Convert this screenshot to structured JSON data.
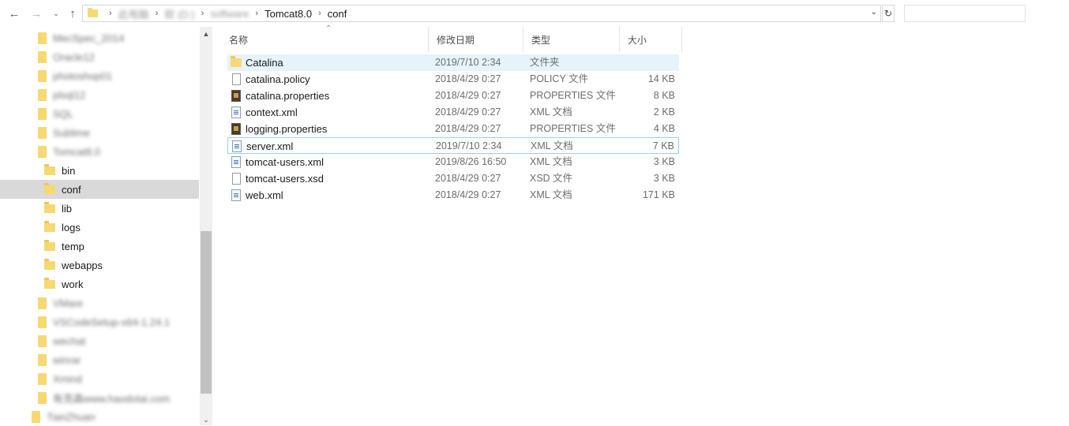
{
  "toolbar": {
    "back_icon": "arrow-left-icon",
    "forward_icon": "arrow-right-icon",
    "recent_icon": "chevron-down-icon",
    "up_icon": "arrow-up-icon"
  },
  "address": {
    "crumbs": [
      "此电脑",
      "软 (D:)",
      "software",
      "Tomcat8.0",
      "conf"
    ],
    "blurred_count": 3,
    "dropdown_icon": "chevron-down-icon",
    "refresh_icon": "refresh-icon"
  },
  "nav": {
    "items": [
      {
        "label": "MecSpec_2014",
        "blur": true,
        "indent": 1
      },
      {
        "label": "Oracle12",
        "blur": true,
        "indent": 1
      },
      {
        "label": "photoshop01",
        "blur": true,
        "indent": 1
      },
      {
        "label": "plsql12",
        "blur": true,
        "indent": 1
      },
      {
        "label": "SQL",
        "blur": true,
        "indent": 1
      },
      {
        "label": "Sublime",
        "blur": true,
        "indent": 1
      },
      {
        "label": "Tomcat8.0",
        "blur": true,
        "indent": 1
      },
      {
        "label": "bin",
        "blur": false,
        "indent": 2
      },
      {
        "label": "conf",
        "blur": false,
        "indent": 2,
        "selected": true
      },
      {
        "label": "lib",
        "blur": false,
        "indent": 2
      },
      {
        "label": "logs",
        "blur": false,
        "indent": 2
      },
      {
        "label": "temp",
        "blur": false,
        "indent": 2
      },
      {
        "label": "webapps",
        "blur": false,
        "indent": 2
      },
      {
        "label": "work",
        "blur": false,
        "indent": 2
      },
      {
        "label": "VMare",
        "blur": true,
        "indent": 1
      },
      {
        "label": "VSCodeSetup-x64-1.24.1",
        "blur": true,
        "indent": 1
      },
      {
        "label": "wechat",
        "blur": true,
        "indent": 1
      },
      {
        "label": "winrar",
        "blur": true,
        "indent": 1
      },
      {
        "label": "Xmind",
        "blur": true,
        "indent": 1
      },
      {
        "label": "有克森www.haodotai.com",
        "blur": true,
        "indent": 1
      },
      {
        "label": "TianZhuan",
        "blur": true,
        "indent": 0
      }
    ]
  },
  "columns": {
    "name": "名称",
    "date": "修改日期",
    "type": "类型",
    "size": "大小"
  },
  "files": [
    {
      "name": "Catalina",
      "date": "2019/7/10 2:34",
      "type": "文件夹",
      "size": "",
      "icon": "folder",
      "state": "hover"
    },
    {
      "name": "catalina.policy",
      "date": "2018/4/29 0:27",
      "type": "POLICY 文件",
      "size": "14 KB",
      "icon": "doc"
    },
    {
      "name": "catalina.properties",
      "date": "2018/4/29 0:27",
      "type": "PROPERTIES 文件",
      "size": "8 KB",
      "icon": "props"
    },
    {
      "name": "context.xml",
      "date": "2018/4/29 0:27",
      "type": "XML 文档",
      "size": "2 KB",
      "icon": "xml"
    },
    {
      "name": "logging.properties",
      "date": "2018/4/29 0:27",
      "type": "PROPERTIES 文件",
      "size": "4 KB",
      "icon": "props"
    },
    {
      "name": "server.xml",
      "date": "2019/7/10 2:34",
      "type": "XML 文档",
      "size": "7 KB",
      "icon": "xml",
      "state": "focus"
    },
    {
      "name": "tomcat-users.xml",
      "date": "2019/8/26 16:50",
      "type": "XML 文档",
      "size": "3 KB",
      "icon": "xml"
    },
    {
      "name": "tomcat-users.xsd",
      "date": "2018/4/29 0:27",
      "type": "XSD 文件",
      "size": "3 KB",
      "icon": "doc"
    },
    {
      "name": "web.xml",
      "date": "2018/4/29 0:27",
      "type": "XML 文档",
      "size": "171 KB",
      "icon": "xml"
    }
  ]
}
